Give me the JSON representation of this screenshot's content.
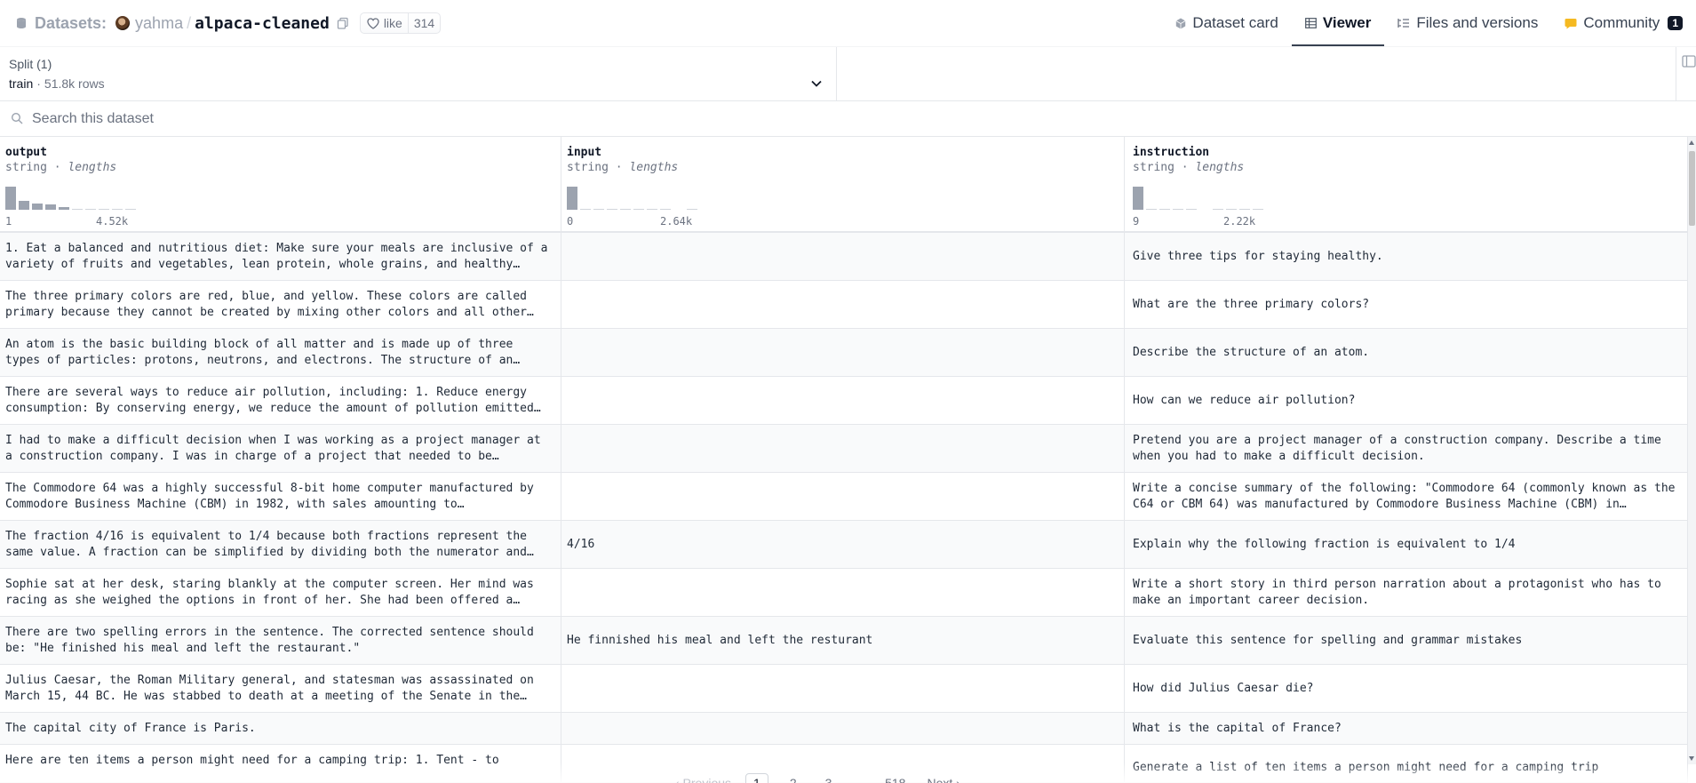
{
  "header": {
    "section": "Datasets:",
    "owner": "yahma",
    "slash": "/",
    "repo": "alpaca-cleaned",
    "like_label": "like",
    "like_count": "314"
  },
  "nav": {
    "tabs": [
      {
        "label": "Dataset card",
        "icon": "dataset-card-icon"
      },
      {
        "label": "Viewer",
        "icon": "table-icon",
        "active": true
      },
      {
        "label": "Files and versions",
        "icon": "files-icon"
      },
      {
        "label": "Community",
        "icon": "community-icon",
        "badge": "1"
      }
    ]
  },
  "split": {
    "label": "Split (1)",
    "name": "train",
    "dot": "·",
    "rows": "51.8k rows"
  },
  "search": {
    "placeholder": "Search this dataset"
  },
  "columns": [
    {
      "name": "output",
      "type": "string",
      "sep": " · ",
      "stat": "lengths",
      "min": "1",
      "max": "4.52k"
    },
    {
      "name": "input",
      "type": "string",
      "sep": " · ",
      "stat": "lengths",
      "min": "0",
      "max": "2.64k"
    },
    {
      "name": "instruction",
      "type": "string",
      "sep": " · ",
      "stat": "lengths",
      "min": "9",
      "max": "2.22k"
    }
  ],
  "rows": [
    {
      "output": "1. Eat a balanced and nutritious diet: Make sure your meals are inclusive of a variety of fruits and vegetables, lean protein, whole grains, and healthy…",
      "input": "",
      "instruction": "Give three tips for staying healthy."
    },
    {
      "output": "The three primary colors are red, blue, and yellow. These colors are called primary because they cannot be created by mixing other colors and all other…",
      "input": "",
      "instruction": "What are the three primary colors?"
    },
    {
      "output": "An atom is the basic building block of all matter and is made up of three types of particles: protons, neutrons, and electrons. The structure of an…",
      "input": "",
      "instruction": "Describe the structure of an atom."
    },
    {
      "output": "There are several ways to reduce air pollution, including: 1. Reduce energy consumption: By conserving energy, we reduce the amount of pollution emitted…",
      "input": "",
      "instruction": "How can we reduce air pollution?"
    },
    {
      "output": "I had to make a difficult decision when I was working as a project manager at a construction company. I was in charge of a project that needed to be…",
      "input": "",
      "instruction": "Pretend you are a project manager of a construction company. Describe a time when you had to make a difficult decision."
    },
    {
      "output": "The Commodore 64 was a highly successful 8-bit home computer manufactured by Commodore Business Machine (CBM) in 1982, with sales amounting to…",
      "input": "",
      "instruction": "Write a concise summary of the following: \"Commodore 64 (commonly known as the C64 or CBM 64) was manufactured by Commodore Business Machine (CBM) in…"
    },
    {
      "output": "The fraction 4/16 is equivalent to 1/4 because both fractions represent the same value. A fraction can be simplified by dividing both the numerator and…",
      "input": "4/16",
      "instruction": "Explain why the following fraction is equivalent to 1/4"
    },
    {
      "output": "Sophie sat at her desk, staring blankly at the computer screen. Her mind was racing as she weighed the options in front of her. She had been offered a…",
      "input": "",
      "instruction": "Write a short story in third person narration about a protagonist who has to make an important career decision."
    },
    {
      "output": "There are two spelling errors in the sentence. The corrected sentence should be: \"He finished his meal and left the restaurant.\"",
      "input": "He finnished his meal and left the resturant",
      "instruction": "Evaluate this sentence for spelling and grammar mistakes"
    },
    {
      "output": "Julius Caesar, the Roman Military general, and statesman was assassinated on March 15, 44 BC. He was stabbed to death at a meeting of the Senate in the…",
      "input": "",
      "instruction": "How did Julius Caesar die?"
    },
    {
      "output": "The capital city of France is Paris.",
      "input": "",
      "instruction": "What is the capital of France?"
    },
    {
      "output": "Here are ten items a person might need for a camping trip: 1. Tent - to",
      "input": "",
      "instruction": "Generate a list of ten items a person might need for a camping trip"
    }
  ],
  "pagination": {
    "prev": "‹ Previous",
    "pages": [
      "1",
      "2",
      "3"
    ],
    "ellipsis": "...",
    "last": "518",
    "next": "Next ›"
  }
}
